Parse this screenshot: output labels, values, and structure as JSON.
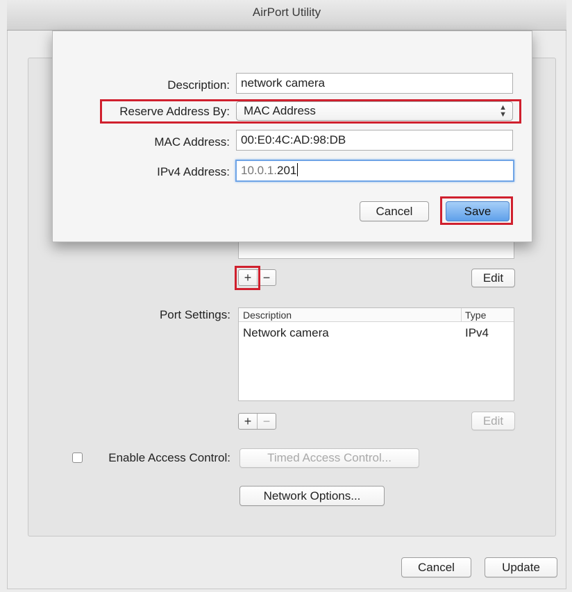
{
  "window": {
    "title": "AirPort Utility"
  },
  "sheet": {
    "description_label": "Description:",
    "description_value": "network camera",
    "reserve_label": "Reserve Address By:",
    "reserve_value": "MAC Address",
    "mac_label": "MAC Address:",
    "mac_value": "00:E0:4C:AD:98:DB",
    "ipv4_label": "IPv4 Address:",
    "ipv4_prefix": "10.0.1.",
    "ipv4_suffix": "201",
    "cancel_label": "Cancel",
    "save_label": "Save"
  },
  "dhcp_controls": {
    "add": "+",
    "remove": "−",
    "edit": "Edit"
  },
  "port_settings": {
    "label": "Port Settings:",
    "columns": [
      "Description",
      "Type"
    ],
    "rows": [
      {
        "description": "Network camera",
        "type": "IPv4"
      }
    ],
    "add": "+",
    "remove": "−",
    "edit": "Edit"
  },
  "access_control": {
    "checkbox_label": "Enable Access Control:",
    "checked": false,
    "timed_button": "Timed Access Control..."
  },
  "network_options_label": "Network Options...",
  "footer": {
    "cancel_label": "Cancel",
    "update_label": "Update"
  },
  "colors": {
    "highlight": "#d0202e",
    "save_blue": "#5fa0ea",
    "focus_ring": "#6fa4e6"
  }
}
